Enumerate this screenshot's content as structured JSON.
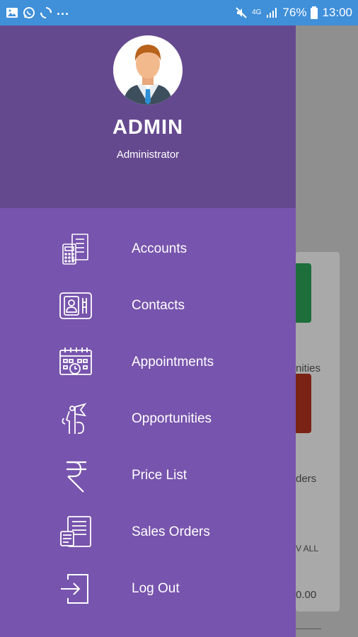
{
  "status_bar": {
    "left_icons": [
      "image-icon",
      "whatsapp-icon",
      "sync-icon"
    ],
    "overflow": "...",
    "battery": "76%",
    "time": "13:00",
    "network": "4G"
  },
  "user": {
    "name": "ADMIN",
    "role": "Administrator"
  },
  "menu": {
    "items": [
      {
        "label": "Accounts",
        "icon": "accounts-icon"
      },
      {
        "label": "Contacts",
        "icon": "contacts-icon"
      },
      {
        "label": "Appointments",
        "icon": "calendar-icon"
      },
      {
        "label": "Opportunities",
        "icon": "opportunities-icon"
      },
      {
        "label": "Price List",
        "icon": "rupee-icon"
      },
      {
        "label": "Sales Orders",
        "icon": "sales-orders-icon"
      },
      {
        "label": "Log Out",
        "icon": "logout-icon"
      }
    ]
  },
  "background": {
    "card1_label": "nities",
    "card2_label": "ders",
    "view_all": "V ALL",
    "amount": "0.00"
  },
  "colors": {
    "status_bar": "#3f8fd9",
    "drawer": "#7754ad",
    "drawer_header": "#65498f"
  }
}
